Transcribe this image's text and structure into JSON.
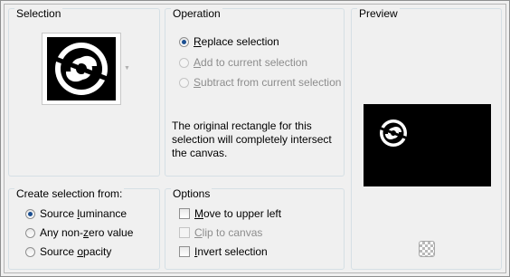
{
  "selection": {
    "title": "Selection",
    "thumbnail_icon": "swirl-logo-thumbnail"
  },
  "operation": {
    "title": "Operation",
    "options": [
      {
        "pre": "",
        "ul": "R",
        "post": "eplace selection",
        "checked": true,
        "disabled": false
      },
      {
        "pre": "",
        "ul": "A",
        "post": "dd to current selection",
        "checked": false,
        "disabled": true
      },
      {
        "pre": "",
        "ul": "S",
        "post": "ubtract from current selection",
        "checked": false,
        "disabled": true
      }
    ],
    "description": "The original rectangle for this selection will completely intersect the canvas."
  },
  "preview": {
    "title": "Preview",
    "zoom_icon": "checkerboard-icon"
  },
  "create_from": {
    "title": "Create selection from:",
    "options": [
      {
        "pre": "Source ",
        "ul": "l",
        "post": "uminance",
        "checked": true
      },
      {
        "pre": "Any non-",
        "ul": "z",
        "post": "ero value",
        "checked": false
      },
      {
        "pre": "Source ",
        "ul": "o",
        "post": "pacity",
        "checked": false
      }
    ]
  },
  "options": {
    "title": "Options",
    "items": [
      {
        "pre": "",
        "ul": "M",
        "post": "ove to upper left",
        "checked": false,
        "disabled": false
      },
      {
        "pre": "",
        "ul": "C",
        "post": "lip to canvas",
        "checked": false,
        "disabled": true
      },
      {
        "pre": "",
        "ul": "I",
        "post": "nvert selection",
        "checked": false,
        "disabled": false
      }
    ]
  },
  "colors": {
    "accent": "#1b4f91",
    "frame_border": "#8e8f8f",
    "panel_bg": "#f0f0f0"
  }
}
